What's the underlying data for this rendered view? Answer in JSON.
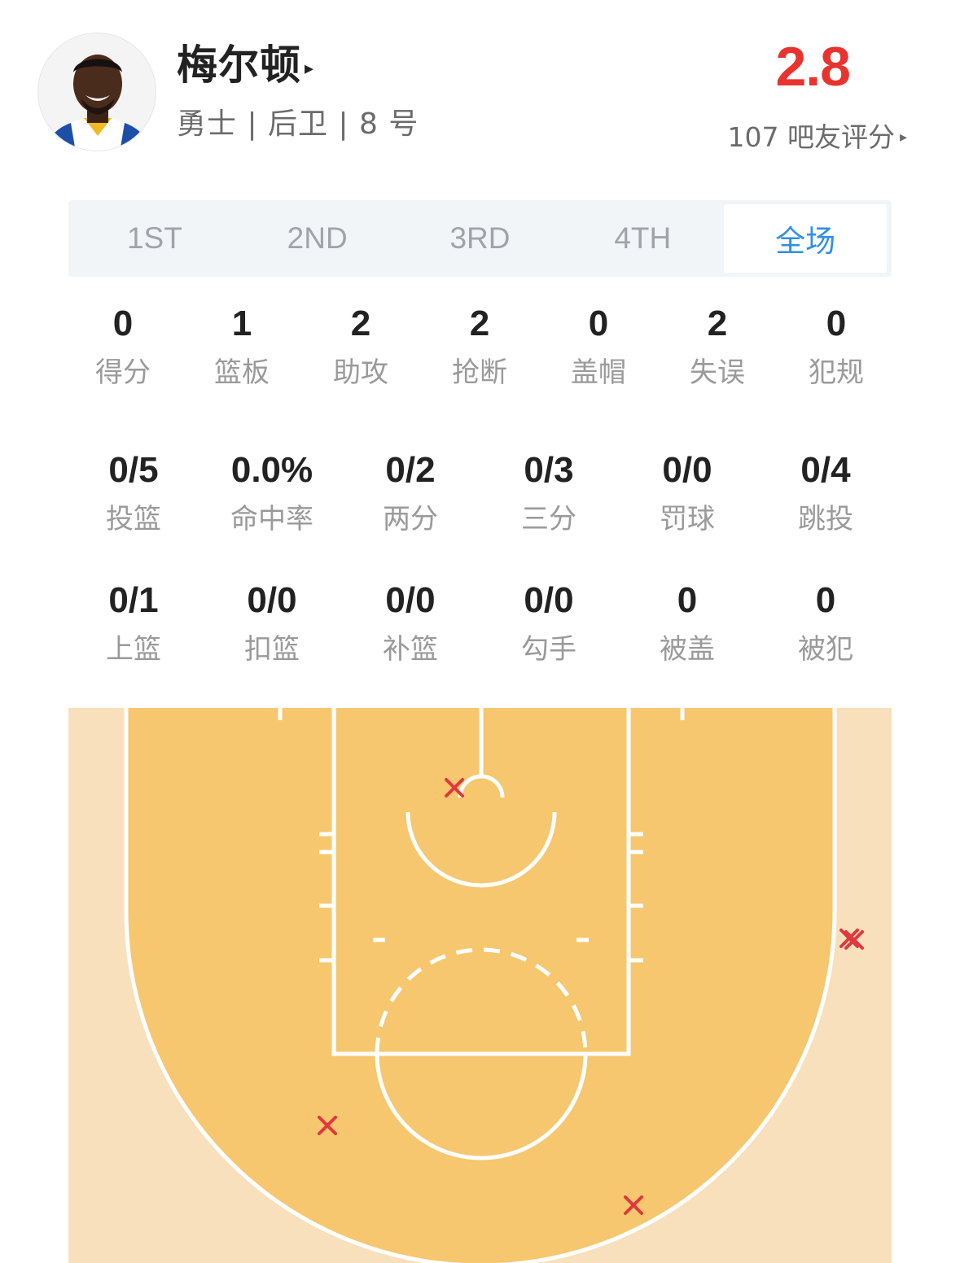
{
  "player": {
    "name": "梅尔顿",
    "name_arrow": "▸",
    "meta": "勇士 | 后卫 | 8 号",
    "avatar_icon": "player-headshot"
  },
  "rating": {
    "score": "2.8",
    "count_label": "107 吧友评分",
    "arrow": "▸",
    "score_color": "#e8332f"
  },
  "tabs": [
    {
      "label": "1ST",
      "active": false
    },
    {
      "label": "2ND",
      "active": false
    },
    {
      "label": "3RD",
      "active": false
    },
    {
      "label": "4TH",
      "active": false
    },
    {
      "label": "全场",
      "active": true
    }
  ],
  "stats_main": [
    {
      "value": "0",
      "label": "得分"
    },
    {
      "value": "1",
      "label": "篮板"
    },
    {
      "value": "2",
      "label": "助攻"
    },
    {
      "value": "2",
      "label": "抢断"
    },
    {
      "value": "0",
      "label": "盖帽"
    },
    {
      "value": "2",
      "label": "失误"
    },
    {
      "value": "0",
      "label": "犯规"
    }
  ],
  "stats_shooting": [
    {
      "value": "0/5",
      "label": "投篮"
    },
    {
      "value": "0.0%",
      "label": "命中率"
    },
    {
      "value": "0/2",
      "label": "两分"
    },
    {
      "value": "0/3",
      "label": "三分"
    },
    {
      "value": "0/0",
      "label": "罚球"
    },
    {
      "value": "0/4",
      "label": "跳投"
    }
  ],
  "stats_shot_types": [
    {
      "value": "0/1",
      "label": "上篮"
    },
    {
      "value": "0/0",
      "label": "扣篮"
    },
    {
      "value": "0/0",
      "label": "补篮"
    },
    {
      "value": "0/0",
      "label": "勾手"
    },
    {
      "value": "0",
      "label": "被盖"
    },
    {
      "value": "0",
      "label": "被犯"
    }
  ],
  "court": {
    "colors": {
      "outer": "#f8e0bd",
      "inner": "#f6c76f",
      "lines": "#ffffff",
      "miss": "#e0383e"
    },
    "shots_missed": 5
  }
}
